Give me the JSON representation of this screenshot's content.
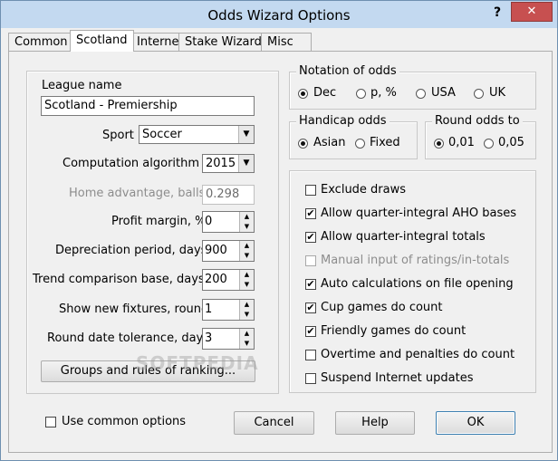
{
  "window": {
    "title": "Odds Wizard Options",
    "help_glyph": "?",
    "close_glyph": "✕"
  },
  "tabs": [
    {
      "label": "Common",
      "active": false
    },
    {
      "label": "Scotland",
      "active": true
    },
    {
      "label": "Internet",
      "active": false
    },
    {
      "label": "Stake Wizard",
      "active": false
    },
    {
      "label": "Misc",
      "active": false
    }
  ],
  "league": {
    "name_label": "League name",
    "name_value": "Scotland - Premiership",
    "sport_label": "Sport",
    "sport_value": "Soccer",
    "algorithm_label": "Computation algorithm of",
    "algorithm_value": "2015",
    "home_adv_label": "Home advantage, balls",
    "home_adv_value": "0.298",
    "profit_label": "Profit margin, %",
    "profit_value": "0",
    "depreciation_label": "Depreciation period, days",
    "depreciation_value": "900",
    "trend_label": "Trend comparison base, days",
    "trend_value": "200",
    "fixtures_label": "Show new fixtures, rounds",
    "fixtures_value": "1",
    "tolerance_label": "Round date tolerance, days",
    "tolerance_value": "3",
    "groups_button": "Groups and rules of ranking..."
  },
  "notation": {
    "legend": "Notation of odds",
    "options": [
      "Dec",
      "p, %",
      "USA",
      "UK"
    ],
    "selected": "Dec"
  },
  "handicap": {
    "legend": "Handicap odds",
    "options": [
      "Asian",
      "Fixed"
    ],
    "selected": "Asian"
  },
  "round_odds": {
    "legend": "Round odds to",
    "options": [
      "0,01",
      "0,05"
    ],
    "selected": "0,01"
  },
  "checks": [
    {
      "label": "Exclude draws",
      "checked": false,
      "enabled": true
    },
    {
      "label": "Allow quarter-integral AHO bases",
      "checked": true,
      "enabled": true
    },
    {
      "label": "Allow quarter-integral totals",
      "checked": true,
      "enabled": true
    },
    {
      "label": "Manual input of ratings/in-totals",
      "checked": false,
      "enabled": false
    },
    {
      "label": "Auto calculations on file opening",
      "checked": true,
      "enabled": true
    },
    {
      "label": "Cup games do count",
      "checked": true,
      "enabled": true
    },
    {
      "label": "Friendly games do count",
      "checked": true,
      "enabled": true
    },
    {
      "label": "Overtime and penalties do count",
      "checked": false,
      "enabled": true
    },
    {
      "label": "Suspend Internet updates",
      "checked": false,
      "enabled": true
    }
  ],
  "footer": {
    "use_common_label": "Use common options",
    "use_common_checked": false,
    "cancel": "Cancel",
    "help": "Help",
    "ok": "OK"
  },
  "watermark": "SOFTPEDIA"
}
